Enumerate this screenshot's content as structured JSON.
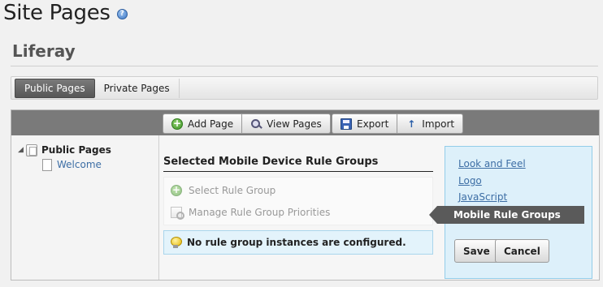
{
  "header": {
    "title": "Site Pages",
    "help_icon": "question-circle-icon"
  },
  "site": {
    "name": "Liferay"
  },
  "tabs": [
    {
      "label": "Public Pages",
      "active": true
    },
    {
      "label": "Private Pages",
      "active": false
    }
  ],
  "toolbar": {
    "add_page": "Add Page",
    "view_pages": "View Pages",
    "export": "Export",
    "import": "Import"
  },
  "tree": {
    "root": "Public Pages",
    "children": [
      "Welcome"
    ]
  },
  "main": {
    "section_title": "Selected Mobile Device Rule Groups",
    "select_rule_group": "Select Rule Group",
    "manage_priorities": "Manage Rule Group Priorities",
    "alert": "No rule group instances are configured."
  },
  "sidebar": {
    "links": [
      "Look and Feel",
      "Logo",
      "JavaScript"
    ],
    "active": "Mobile Rule Groups",
    "save": "Save",
    "cancel": "Cancel"
  },
  "colors": {
    "toolbar_bg": "#7a7a7a",
    "active_tab": "#575757",
    "link": "#3d6ea5",
    "sidepanel_bg": "#ddf0fa",
    "alert_bg": "#e3f3fb"
  }
}
